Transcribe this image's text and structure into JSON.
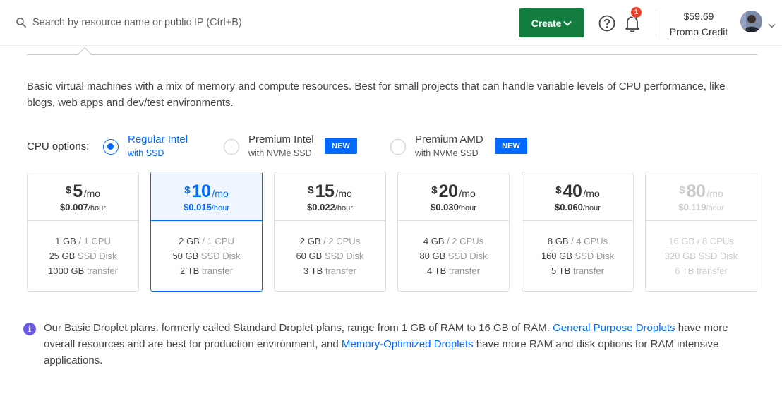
{
  "header": {
    "search_placeholder": "Search by resource name or public IP (Ctrl+B)",
    "create_label": "Create",
    "notification_count": "1",
    "credit_amount": "$59.69",
    "credit_label": "Promo Credit",
    "icons": [
      "search-icon",
      "chevron-down-icon",
      "help-icon",
      "bell-icon",
      "avatar",
      "chevron-down-icon"
    ]
  },
  "description": "Basic virtual machines with a mix of memory and compute resources. Best for small projects that can handle variable levels of CPU performance, like blogs, web apps and dev/test environments.",
  "cpu_options": {
    "label": "CPU options:",
    "options": [
      {
        "title": "Regular Intel",
        "subtitle": "with SSD",
        "selected": true
      },
      {
        "title": "Premium Intel",
        "subtitle": "with NVMe SSD",
        "badge": "NEW",
        "selected": false
      },
      {
        "title": "Premium AMD",
        "subtitle": "with NVMe SSD",
        "badge": "NEW",
        "selected": false
      }
    ]
  },
  "plans": [
    {
      "currency": "$",
      "price": "5",
      "per": "/mo",
      "hourly": "$0.007",
      "hourly_unit": "/hour",
      "ram": "1 GB",
      "cpu": "/ 1 CPU",
      "disk": "25 GB",
      "disk_label": "SSD Disk",
      "transfer": "1000 GB",
      "transfer_label": "transfer",
      "state": "normal"
    },
    {
      "currency": "$",
      "price": "10",
      "per": "/mo",
      "hourly": "$0.015",
      "hourly_unit": "/hour",
      "ram": "2 GB",
      "cpu": "/ 1 CPU",
      "disk": "50 GB",
      "disk_label": "SSD Disk",
      "transfer": "2 TB",
      "transfer_label": "transfer",
      "state": "selected"
    },
    {
      "currency": "$",
      "price": "15",
      "per": "/mo",
      "hourly": "$0.022",
      "hourly_unit": "/hour",
      "ram": "2 GB",
      "cpu": "/ 2 CPUs",
      "disk": "60 GB",
      "disk_label": "SSD Disk",
      "transfer": "3 TB",
      "transfer_label": "transfer",
      "state": "normal"
    },
    {
      "currency": "$",
      "price": "20",
      "per": "/mo",
      "hourly": "$0.030",
      "hourly_unit": "/hour",
      "ram": "4 GB",
      "cpu": "/ 2 CPUs",
      "disk": "80 GB",
      "disk_label": "SSD Disk",
      "transfer": "4 TB",
      "transfer_label": "transfer",
      "state": "normal"
    },
    {
      "currency": "$",
      "price": "40",
      "per": "/mo",
      "hourly": "$0.060",
      "hourly_unit": "/hour",
      "ram": "8 GB",
      "cpu": "/ 4 CPUs",
      "disk": "160 GB",
      "disk_label": "SSD Disk",
      "transfer": "5 TB",
      "transfer_label": "transfer",
      "state": "normal"
    },
    {
      "currency": "$",
      "price": "80",
      "per": "/mo",
      "hourly": "$0.119",
      "hourly_unit": "/hour",
      "ram": "16 GB",
      "cpu": "/ 8 CPUs",
      "disk": "320 GB",
      "disk_label": "SSD Disk",
      "transfer": "6 TB",
      "transfer_label": "transfer",
      "state": "disabled"
    }
  ],
  "info": {
    "icon": "info-icon",
    "text_1": "Our Basic Droplet plans, formerly called Standard Droplet plans, range from 1 GB of RAM to 16 GB of RAM.",
    "link_1": "General Purpose Droplets",
    "text_2": "have more overall resources and are best for production environment, and",
    "link_2": "Memory-Optimized Droplets",
    "text_3": "have more RAM and disk options for RAM intensive applications."
  },
  "colors": {
    "accent": "#0069ff",
    "create_button": "#137c3f",
    "badge_red": "#e5422b",
    "info_purple": "#6b5ce7"
  }
}
